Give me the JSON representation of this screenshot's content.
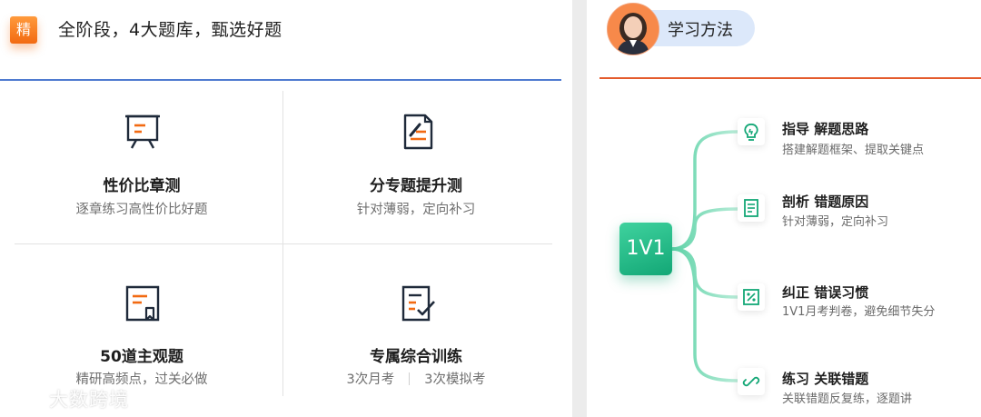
{
  "left": {
    "badge": "精",
    "title": "全阶段，4大题库，甄选好题",
    "cells": [
      {
        "name": "性价比章测",
        "desc": "逐章练习高性价比好题",
        "icon": "presentation-board-icon"
      },
      {
        "name": "分专题提升测",
        "desc": "针对薄弱，定向补习",
        "icon": "document-edit-icon"
      },
      {
        "name": "50道主观题",
        "desc": "精研高频点，过关必做",
        "icon": "bookmark-document-icon"
      },
      {
        "name": "专属综合训练",
        "desc_a": "3次月考",
        "desc_b": "3次模拟考",
        "icon": "document-check-icon"
      }
    ]
  },
  "watermark": "大数跨境",
  "right": {
    "title": "学习方法",
    "hub": "1V1",
    "nodes": [
      {
        "title": "指导 解题思路",
        "desc": "搭建解题框架、提取关键点",
        "icon": "lightbulb-icon"
      },
      {
        "title": "剖析 错题原因",
        "desc": "针对薄弱，定向补习",
        "icon": "document-lines-icon"
      },
      {
        "title": "纠正 错误习惯",
        "desc": "1V1月考判卷，避免细节失分",
        "icon": "percent-icon"
      },
      {
        "title": "练习 关联错题",
        "desc": "关联错题反复练，逐题讲",
        "icon": "link-icon"
      }
    ]
  },
  "colors": {
    "orange": "#f26a12",
    "blue_line": "#4f7bd0",
    "red_line": "#e45b2c",
    "green": "#13a776"
  }
}
